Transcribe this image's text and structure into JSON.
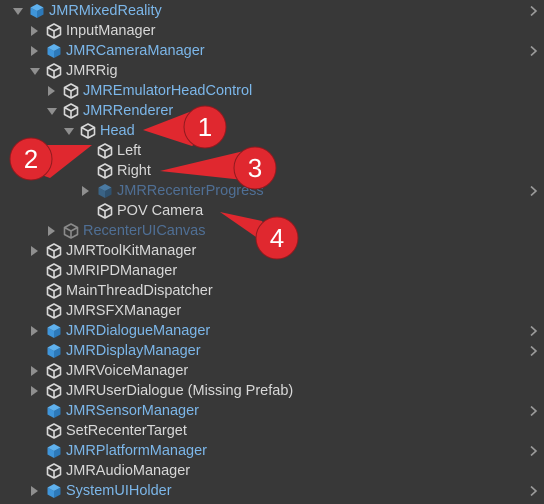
{
  "hierarchy": {
    "rows": [
      {
        "name": "JMRMixedReality",
        "color": "blue",
        "icon": "prefab-icon",
        "arrow": "expanded",
        "chevron": true
      },
      {
        "name": "InputManager",
        "color": "white",
        "icon": "gameobject-icon",
        "arrow": "collapsed",
        "chevron": false
      },
      {
        "name": "JMRCameraManager",
        "color": "blue",
        "icon": "prefab-icon",
        "arrow": "collapsed",
        "chevron": true
      },
      {
        "name": "JMRRig",
        "color": "white",
        "icon": "gameobject-icon",
        "arrow": "expanded",
        "chevron": false
      },
      {
        "name": "JMREmulatorHeadControl",
        "color": "blue",
        "icon": "gameobject-icon",
        "arrow": "collapsed",
        "chevron": false
      },
      {
        "name": "JMRRenderer",
        "color": "blue",
        "icon": "gameobject-icon",
        "arrow": "expanded",
        "chevron": false
      },
      {
        "name": "Head",
        "color": "blue",
        "icon": "gameobject-icon",
        "arrow": "expanded",
        "chevron": false
      },
      {
        "name": "Left",
        "color": "white",
        "icon": "gameobject-icon",
        "arrow": "none",
        "chevron": false
      },
      {
        "name": "Right",
        "color": "white",
        "icon": "gameobject-icon",
        "arrow": "none",
        "chevron": false
      },
      {
        "name": "JMRRecenterProgress",
        "color": "blue-dim",
        "icon": "prefab-icon-dim",
        "arrow": "collapsed",
        "chevron": true
      },
      {
        "name": "POV Camera",
        "color": "white",
        "icon": "gameobject-icon",
        "arrow": "none",
        "chevron": false
      },
      {
        "name": "RecenterUICanvas",
        "color": "blue-dim",
        "icon": "gameobject-icon-dim",
        "arrow": "collapsed",
        "chevron": false
      },
      {
        "name": "JMRToolKitManager",
        "color": "white",
        "icon": "gameobject-icon",
        "arrow": "collapsed",
        "chevron": false
      },
      {
        "name": "JMRIPDManager",
        "color": "white",
        "icon": "gameobject-icon",
        "arrow": "none",
        "chevron": false
      },
      {
        "name": "MainThreadDispatcher",
        "color": "white",
        "icon": "gameobject-icon",
        "arrow": "none",
        "chevron": false
      },
      {
        "name": "JMRSFXManager",
        "color": "white",
        "icon": "gameobject-icon",
        "arrow": "none",
        "chevron": false
      },
      {
        "name": "JMRDialogueManager",
        "color": "blue",
        "icon": "prefab-icon",
        "arrow": "collapsed",
        "chevron": true
      },
      {
        "name": "JMRDisplayManager",
        "color": "blue",
        "icon": "prefab-icon",
        "arrow": "none",
        "chevron": true
      },
      {
        "name": "JMRVoiceManager",
        "color": "white",
        "icon": "gameobject-icon",
        "arrow": "collapsed",
        "chevron": false
      },
      {
        "name": "JMRUserDialogue (Missing Prefab)",
        "color": "white",
        "icon": "gameobject-icon",
        "arrow": "collapsed",
        "chevron": false
      },
      {
        "name": "JMRSensorManager",
        "color": "blue",
        "icon": "prefab-icon",
        "arrow": "none",
        "chevron": true
      },
      {
        "name": "SetRecenterTarget",
        "color": "white",
        "icon": "gameobject-icon",
        "arrow": "none",
        "chevron": false
      },
      {
        "name": "JMRPlatformManager",
        "color": "blue",
        "icon": "prefab-icon",
        "arrow": "none",
        "chevron": true
      },
      {
        "name": "JMRAudioManager",
        "color": "white",
        "icon": "gameobject-icon",
        "arrow": "none",
        "chevron": false
      },
      {
        "name": "SystemUIHolder",
        "color": "blue",
        "icon": "prefab-icon",
        "arrow": "collapsed",
        "chevron": true
      }
    ]
  },
  "callouts": [
    {
      "number": "1",
      "points_to": "Head"
    },
    {
      "number": "2",
      "points_to": "Left"
    },
    {
      "number": "3",
      "points_to": "Right"
    },
    {
      "number": "4",
      "points_to": "POV Camera"
    }
  ],
  "colors": {
    "background": "#383838",
    "text": "#d8d8d8",
    "prefab_text": "#7cb7ea",
    "callout_fill": "#e0282f",
    "callout_text": "#ffffff"
  }
}
